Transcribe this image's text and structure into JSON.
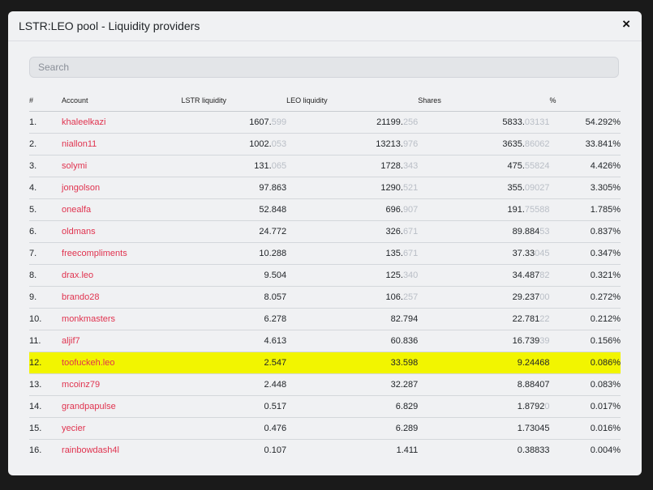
{
  "modal": {
    "title": "LSTR:LEO pool - Liquidity providers",
    "close": "×"
  },
  "search": {
    "placeholder": "Search",
    "value": ""
  },
  "table": {
    "headers": [
      "#",
      "Account",
      "LSTR liquidity",
      "LEO liquidity",
      "Shares",
      "%"
    ],
    "rows": [
      {
        "rank": "1.",
        "account": "khaleelkazi",
        "lstr": {
          "main": "1607.",
          "dim": "599"
        },
        "leo": {
          "main": "21199.",
          "dim": "256"
        },
        "shares": {
          "main": "5833.",
          "dim": "03131"
        },
        "pct": "54.292%"
      },
      {
        "rank": "2.",
        "account": "niallon11",
        "lstr": {
          "main": "1002.",
          "dim": "053"
        },
        "leo": {
          "main": "13213.",
          "dim": "976"
        },
        "shares": {
          "main": "3635.",
          "dim": "86062"
        },
        "pct": "33.841%"
      },
      {
        "rank": "3.",
        "account": "solymi",
        "lstr": {
          "main": "131.",
          "dim": "065"
        },
        "leo": {
          "main": "1728.",
          "dim": "343"
        },
        "shares": {
          "main": "475.",
          "dim": "55824"
        },
        "pct": "4.426%"
      },
      {
        "rank": "4.",
        "account": "jongolson",
        "lstr": {
          "main": "97.863",
          "dim": ""
        },
        "leo": {
          "main": "1290.",
          "dim": "521"
        },
        "shares": {
          "main": "355.",
          "dim": "09027"
        },
        "pct": "3.305%"
      },
      {
        "rank": "5.",
        "account": "onealfa",
        "lstr": {
          "main": "52.848",
          "dim": ""
        },
        "leo": {
          "main": "696.",
          "dim": "907"
        },
        "shares": {
          "main": "191.",
          "dim": "75588"
        },
        "pct": "1.785%"
      },
      {
        "rank": "6.",
        "account": "oldmans",
        "lstr": {
          "main": "24.772",
          "dim": ""
        },
        "leo": {
          "main": "326.",
          "dim": "671"
        },
        "shares": {
          "main": "89.884",
          "dim": "53"
        },
        "pct": "0.837%"
      },
      {
        "rank": "7.",
        "account": "freecompliments",
        "lstr": {
          "main": "10.288",
          "dim": ""
        },
        "leo": {
          "main": "135.",
          "dim": "671"
        },
        "shares": {
          "main": "37.33",
          "dim": "045"
        },
        "pct": "0.347%"
      },
      {
        "rank": "8.",
        "account": "drax.leo",
        "lstr": {
          "main": "9.504",
          "dim": ""
        },
        "leo": {
          "main": "125.",
          "dim": "340"
        },
        "shares": {
          "main": "34.487",
          "dim": "82"
        },
        "pct": "0.321%"
      },
      {
        "rank": "9.",
        "account": "brando28",
        "lstr": {
          "main": "8.057",
          "dim": ""
        },
        "leo": {
          "main": "106.",
          "dim": "257"
        },
        "shares": {
          "main": "29.237",
          "dim": "00"
        },
        "pct": "0.272%"
      },
      {
        "rank": "10.",
        "account": "monkmasters",
        "lstr": {
          "main": "6.278",
          "dim": ""
        },
        "leo": {
          "main": "82.794",
          "dim": ""
        },
        "shares": {
          "main": "22.781",
          "dim": "22"
        },
        "pct": "0.212%"
      },
      {
        "rank": "11.",
        "account": "aljif7",
        "lstr": {
          "main": "4.613",
          "dim": ""
        },
        "leo": {
          "main": "60.836",
          "dim": ""
        },
        "shares": {
          "main": "16.739",
          "dim": "39"
        },
        "pct": "0.156%"
      },
      {
        "rank": "12.",
        "account": "toofuckeh.leo",
        "lstr": {
          "main": "2.547",
          "dim": ""
        },
        "leo": {
          "main": "33.598",
          "dim": ""
        },
        "shares": {
          "main": "9.24468",
          "dim": ""
        },
        "pct": "0.086%",
        "highlighted": true
      },
      {
        "rank": "13.",
        "account": "mcoinz79",
        "lstr": {
          "main": "2.448",
          "dim": ""
        },
        "leo": {
          "main": "32.287",
          "dim": ""
        },
        "shares": {
          "main": "8.88407",
          "dim": ""
        },
        "pct": "0.083%"
      },
      {
        "rank": "14.",
        "account": "grandpapulse",
        "lstr": {
          "main": "0.517",
          "dim": ""
        },
        "leo": {
          "main": "6.829",
          "dim": ""
        },
        "shares": {
          "main": "1.8792",
          "dim": "0"
        },
        "pct": "0.017%"
      },
      {
        "rank": "15.",
        "account": "yecier",
        "lstr": {
          "main": "0.476",
          "dim": ""
        },
        "leo": {
          "main": "6.289",
          "dim": ""
        },
        "shares": {
          "main": "1.73045",
          "dim": ""
        },
        "pct": "0.016%"
      },
      {
        "rank": "16.",
        "account": "rainbowdash4l",
        "lstr": {
          "main": "0.107",
          "dim": ""
        },
        "leo": {
          "main": "1.411",
          "dim": ""
        },
        "shares": {
          "main": "0.38833",
          "dim": ""
        },
        "pct": "0.004%"
      }
    ]
  },
  "colors": {
    "account_link": "#e0334f",
    "highlight": "#f2f500",
    "dim_digits": "#b9bec6"
  }
}
